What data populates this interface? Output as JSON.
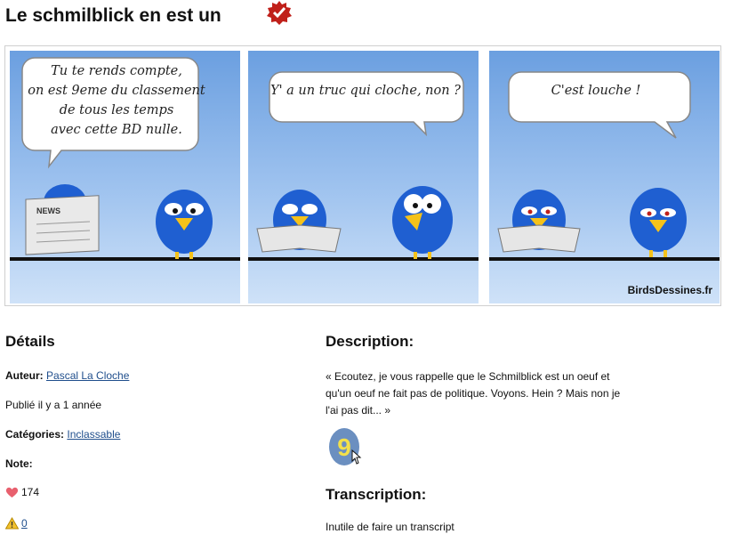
{
  "page": {
    "title": "Le schmilblick en est un"
  },
  "comic": {
    "panels": [
      {
        "bubble": [
          "Tu te rends compte,",
          "on est 9eme du classement",
          "de tous les temps",
          "avec cette BD nulle."
        ],
        "newspaper_label": "NEWS"
      },
      {
        "bubble": [
          "Y' a un truc qui cloche, non ?"
        ]
      },
      {
        "bubble": [
          "C'est louche !"
        ]
      }
    ],
    "watermark": "BirdsDessines.fr",
    "colors": {
      "sky_top": "#6b9fe0",
      "bird_blue": "#1f5fd1",
      "beak": "#f5c21a"
    }
  },
  "details": {
    "heading": "Détails",
    "author_label": "Auteur:",
    "author_name": "Pascal La Cloche",
    "published": "Publié il y a 1 année",
    "categories_label": "Catégories:",
    "category": "Inclassable",
    "rating_label": "Note:",
    "likes": "174",
    "reports": "0"
  },
  "description": {
    "heading": "Description:",
    "text": "« Ecoutez, je vous rappelle que le Schmilblick est un oeuf et qu'un oeuf ne fait pas de politique. Voyons. Hein ? Mais non je l'ai pas dit... »",
    "egg_icon": "nine-egg-icon"
  },
  "transcription": {
    "heading": "Transcription:",
    "text": "Inutile de faire un transcript"
  }
}
